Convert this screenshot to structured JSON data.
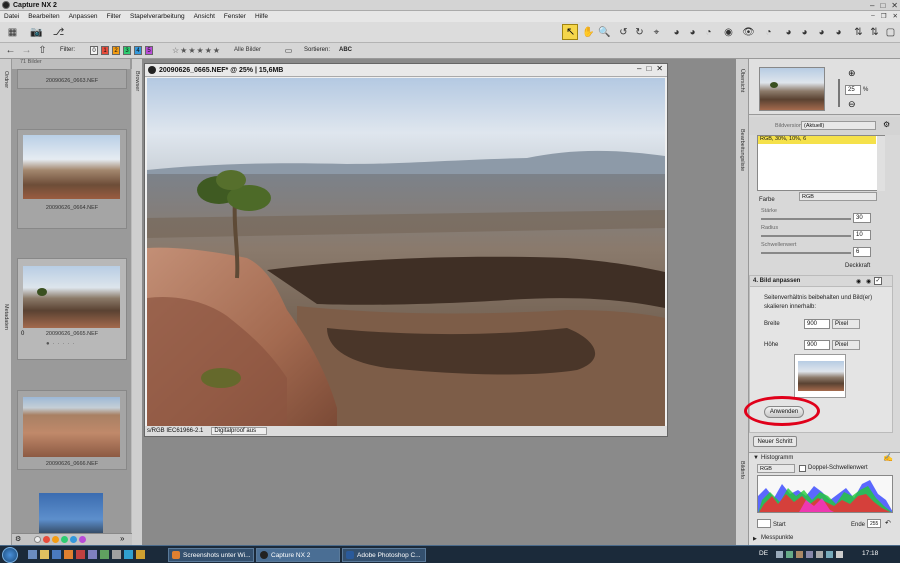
{
  "window": {
    "title": "Capture NX 2"
  },
  "menu": [
    "Datei",
    "Bearbeiten",
    "Anpassen",
    "Filter",
    "Stapelverarbeitung",
    "Ansicht",
    "Fenster",
    "Hilfe"
  ],
  "filterbar": {
    "filter_label": "Filter:",
    "swatches": [
      "0",
      "1",
      "2",
      "3",
      "4",
      "5"
    ],
    "rating": "☆★★★★★",
    "all_images": "Alle Bilder",
    "sort_label": "Sortieren:",
    "sort_value": "ABC"
  },
  "side_labels": {
    "ordner": "Ordner",
    "metadaten": "Metadaten",
    "browser": "Browser",
    "uebersicht": "Übersicht",
    "bearbeitungsliste": "Bearbeitungsliste",
    "bildinfo": "Bildinfo"
  },
  "browser": {
    "header": "71 Bilder",
    "thumbs": [
      {
        "label": "20090626_0663.NEF"
      },
      {
        "label": "20090626_0664.NEF"
      },
      {
        "label": "20090626_0665.NEF"
      },
      {
        "label": "20090626_0666.NEF"
      },
      {
        "label": ""
      }
    ],
    "rating_mark": "0"
  },
  "viewer": {
    "title": "20090626_0665.NEF* @ 25% | 15,6MB",
    "profile": "s/RGB IEC61966-2.1",
    "softproof": "Digitalproof aus"
  },
  "overview": {
    "zoom": "25",
    "zoom_unit": "%"
  },
  "edit_panel": {
    "version_label": "Bildversion:",
    "version_value": "(Aktuell)",
    "list_item": "RGB, 30%, 10%, 6",
    "channel": "RGB",
    "farbe_label": "Farbe",
    "staerke_label": "Stärke",
    "staerke_value": "30",
    "radius_label": "Radius",
    "radius_value": "10",
    "schwellenwert_label": "Schwellenwert",
    "schwellenwert_value": "6",
    "deckkraft_label": "Deckkraft",
    "step_title": "4. Bild anpassen",
    "description": "Seitenverhältnis beibehalten und Bild(er) skalieren innerhalb:",
    "breite_label": "Breite",
    "breite_value": "900",
    "breite_unit": "Pixel",
    "hoehe_label": "Höhe",
    "hoehe_value": "900",
    "hoehe_unit": "Pixel",
    "apply_button": "Anwenden",
    "new_step_button": "Neuer Schritt",
    "highlight_color": "#e0001a"
  },
  "histogram": {
    "title": "Histogramm",
    "channel": "RGB",
    "double_threshold": "Doppel-Schwellenwert",
    "start_label": "Start",
    "end_label": "Ende",
    "end_value": "255"
  },
  "messpunkte": "Messpunkte",
  "taskbar": {
    "items": [
      {
        "label": "Screenshots unter Wi..."
      },
      {
        "label": "Capture NX 2"
      },
      {
        "label": "Adobe Photoshop C..."
      }
    ],
    "lang": "DE",
    "time": "17:18"
  }
}
